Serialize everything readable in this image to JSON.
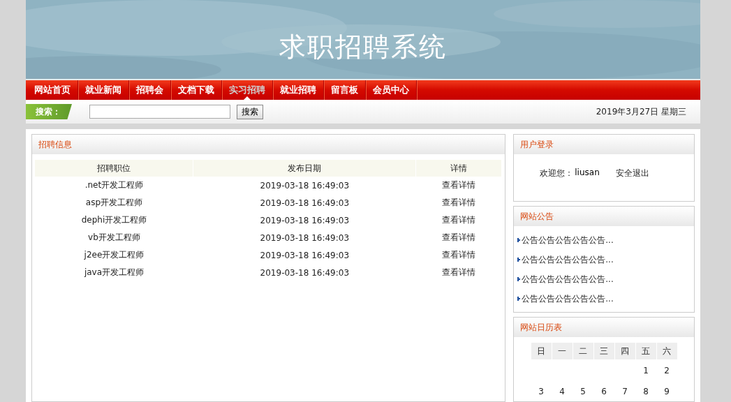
{
  "header": {
    "title": "求职招聘系统"
  },
  "nav": [
    {
      "label": "网站首页",
      "selected": false
    },
    {
      "label": "就业新闻",
      "selected": false
    },
    {
      "label": "招聘会",
      "selected": false
    },
    {
      "label": "文档下载",
      "selected": false
    },
    {
      "label": "实习招聘",
      "selected": true
    },
    {
      "label": "就业招聘",
      "selected": false
    },
    {
      "label": "留言板",
      "selected": false
    },
    {
      "label": "会员中心",
      "selected": false
    }
  ],
  "search": {
    "label": "搜索：",
    "button": "搜索",
    "date": "2019年3月27日 星期三"
  },
  "jobs": {
    "title": "招聘信息",
    "columns": [
      "招聘职位",
      "发布日期",
      "详情"
    ],
    "rows": [
      {
        "position": ".net开发工程师",
        "date": "2019-03-18 16:49:03",
        "link": "查看详情"
      },
      {
        "position": "asp开发工程师",
        "date": "2019-03-18 16:49:03",
        "link": "查看详情"
      },
      {
        "position": "dephi开发工程师",
        "date": "2019-03-18 16:49:03",
        "link": "查看详情"
      },
      {
        "position": "vb开发工程师",
        "date": "2019-03-18 16:49:03",
        "link": "查看详情"
      },
      {
        "position": "j2ee开发工程师",
        "date": "2019-03-18 16:49:03",
        "link": "查看详情"
      },
      {
        "position": "java开发工程师",
        "date": "2019-03-18 16:49:03",
        "link": "查看详情"
      }
    ]
  },
  "login": {
    "title": "用户登录",
    "welcome": "欢迎您：",
    "username": "liusan",
    "logout": "安全退出"
  },
  "notices": {
    "title": "网站公告",
    "items": [
      "公告公告公告公告公告...",
      "公告公告公告公告公告...",
      "公告公告公告公告公告...",
      "公告公告公告公告公告..."
    ]
  },
  "calendar": {
    "title": "网站日历表",
    "weekdays": [
      "日",
      "一",
      "二",
      "三",
      "四",
      "五",
      "六"
    ],
    "weeks": [
      [
        {
          "kind": "blank"
        },
        {
          "kind": "blank"
        },
        {
          "kind": "blank"
        },
        {
          "kind": "blank"
        },
        {
          "kind": "blank"
        },
        {
          "kind": "day",
          "label": "1"
        },
        {
          "kind": "day",
          "label": "2"
        }
      ],
      [
        {
          "kind": "day",
          "label": "3"
        },
        {
          "kind": "day",
          "label": "4"
        },
        {
          "kind": "day",
          "label": "5"
        },
        {
          "kind": "day",
          "label": "6"
        },
        {
          "kind": "day",
          "label": "7"
        },
        {
          "kind": "day",
          "label": "8"
        },
        {
          "kind": "day",
          "label": "9"
        }
      ]
    ]
  }
}
